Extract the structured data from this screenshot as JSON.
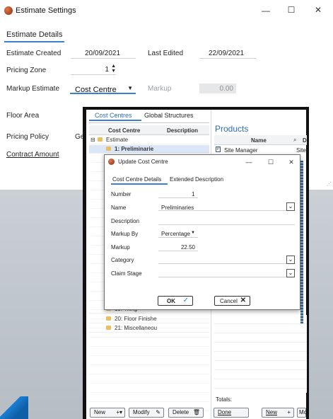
{
  "settings_window": {
    "title": "Estimate Settings",
    "minimize": "—",
    "maximize": "☐",
    "close": "✕",
    "tab": "Estimate Details",
    "estimate_created_label": "Estimate Created",
    "estimate_created_value": "20/09/2021",
    "last_edited_label": "Last Edited",
    "last_edited_value": "22/09/2021",
    "pricing_zone_label": "Pricing Zone",
    "pricing_zone_value": "1",
    "markup_estimate_label": "Markup Estimate",
    "markup_estimate_value": "Cost Centre",
    "markup_label": "Markup",
    "markup_value": "0.00",
    "floor_area_label": "Floor Area",
    "pricing_policy_label": "Pricing Policy",
    "pricing_policy_value": "Ge",
    "contract_amount_label": "Contract Amount"
  },
  "cost_centres": {
    "tab_cost_centres": "Cost Centres",
    "tab_global_structures": "Global Structures",
    "col_cost_centre": "Cost Centre",
    "col_description": "Description",
    "rows": [
      {
        "expander": "⊟",
        "label": "Estimate"
      },
      {
        "expander": "",
        "label": "1: Preliminarie"
      }
    ],
    "bottom_rows": [
      {
        "label": "19: Tiling"
      },
      {
        "label": "20: Floor Finishe"
      },
      {
        "label": "21: Miscellaneou"
      }
    ],
    "products_title": "Products",
    "products_col_name": "Name",
    "products_col_d": "D",
    "products_row_name": "Site Manager",
    "products_row_d": "Site",
    "totals_label": "Totals:",
    "new_btn": "New",
    "modify_btn": "Modify",
    "delete_btn": "Delete",
    "done_btn": "Done",
    "new_btn2": "New",
    "more_btn": "Mo"
  },
  "dialog": {
    "title": "Update Cost Centre",
    "tab_details": "Cost Centre Details",
    "tab_extended": "Extended Description",
    "number_label": "Number",
    "number_value": "1",
    "name_label": "Name",
    "name_value": "Preliminaries",
    "description_label": "Description",
    "markup_by_label": "Markup By",
    "markup_by_value": "Percentage",
    "markup_label": "Markup",
    "markup_value": "22.50",
    "category_label": "Category",
    "claim_stage_label": "Claim Stage",
    "ok_btn": "OK",
    "cancel_btn": "Cancel",
    "minimize": "—",
    "maximize": "☐",
    "close": "✕"
  },
  "colors": {
    "accent": "#3b7fd1",
    "products_title": "#2a6cc0"
  }
}
